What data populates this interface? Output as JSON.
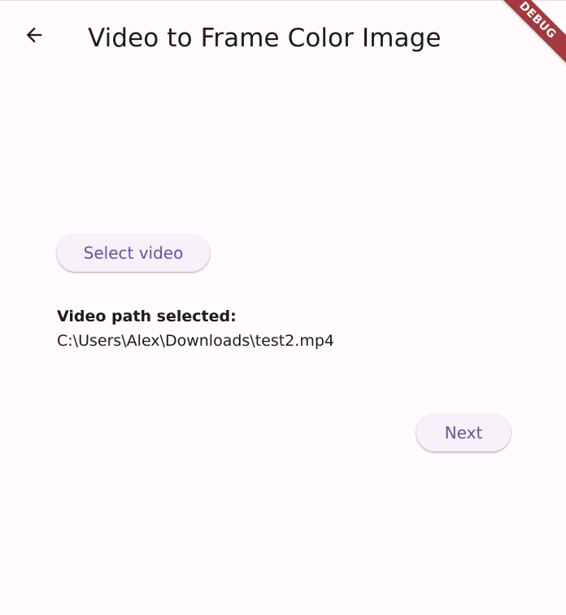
{
  "appbar": {
    "title": "Video to Frame Color Image",
    "back_icon": "arrow-back-icon"
  },
  "debug_banner": {
    "label": "DEBUG",
    "color": "#a33a3f"
  },
  "actions": {
    "select_video_label": "Select video",
    "next_label": "Next"
  },
  "selection": {
    "label": "Video path selected:",
    "path": "C:\\Users\\Alex\\Downloads\\test2.mp4"
  },
  "colors": {
    "background": "#fffbfe",
    "accent": "#6750a4",
    "button_surface": "#f7f2fa",
    "text": "#1c1b1f"
  }
}
